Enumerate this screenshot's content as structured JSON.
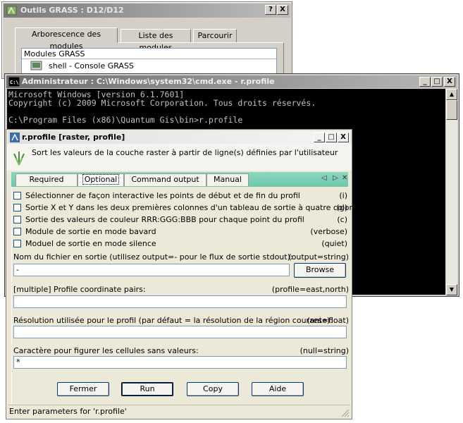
{
  "grass_window": {
    "title": "Outils GRASS : D12/D12",
    "help_btn": "?",
    "close_btn": "X",
    "tabs": [
      "Arborescence des modules",
      "Liste des modules",
      "Parcourir"
    ],
    "tree": {
      "root": "Modules GRASS",
      "item": "shell - Console GRASS"
    }
  },
  "cmd_window": {
    "title": "Administrateur : C:\\Windows\\system32\\cmd.exe - r.profile",
    "lines": [
      "Microsoft Windows [version 6.1.7601]",
      "Copyright (c) 2009 Microsoft Corporation. Tous droits réservés.",
      "",
      "C:\\Program Files (x86)\\Quantum Gis\\bin>r.profile"
    ]
  },
  "dialog": {
    "title": "r.profile [raster, profile]",
    "description": "Sort les valeurs de la couche raster à partir de ligne(s) définies par l'utilisateur",
    "tabs": [
      "Required",
      "Optional",
      "Command output",
      "Manual"
    ],
    "active_tab": "Optional",
    "tab_controls": {
      "prev": "◁",
      "next": "▷",
      "close": "✕"
    },
    "options": [
      {
        "label": "Sélectionner de façon interactive les points de début et de fin du  profil",
        "flag": "(i)"
      },
      {
        "label": "Sortie X et Y dans les deux premières colonnes d'un tableau de sortie  à quatre colonnes",
        "flag": "(g)"
      },
      {
        "label": "Sortie des valeurs de couleur RRR:GGG:BBB pour chaque point du profil",
        "flag": "(c)"
      },
      {
        "label": "Module de sortie en mode bavard",
        "flag": "(verbose)"
      },
      {
        "label": "Moduel de sortie en mode silence",
        "flag": "(quiet)"
      }
    ],
    "output": {
      "label": "Nom du fichier en sortie (utilisez output=- pour le flux de sortie  stdout):",
      "flag": "(output=string)",
      "value": "-",
      "browse": "Browse"
    },
    "profile": {
      "label": "[multiple] Profile coordinate pairs:",
      "flag": "(profile=east,north)",
      "value": ""
    },
    "resolution": {
      "label": "Résolution utilisée pour le profil (par défaut = la résolution de la  région courante):",
      "flag": "(res=float)",
      "value": ""
    },
    "null": {
      "label": "Caractère pour figurer les cellules sans valeurs:",
      "flag": "(null=string)",
      "value": "*"
    },
    "buttons": {
      "close": "Fermer",
      "run": "Run",
      "copy": "Copy",
      "help": "Aide"
    },
    "status": "Enter parameters for 'r.profile'"
  },
  "colors": {
    "tab_strip": "#6cc8a8",
    "dialog_bg": "#ece9d8",
    "console_bg": "#000000",
    "console_text": "#c0c0c0"
  }
}
